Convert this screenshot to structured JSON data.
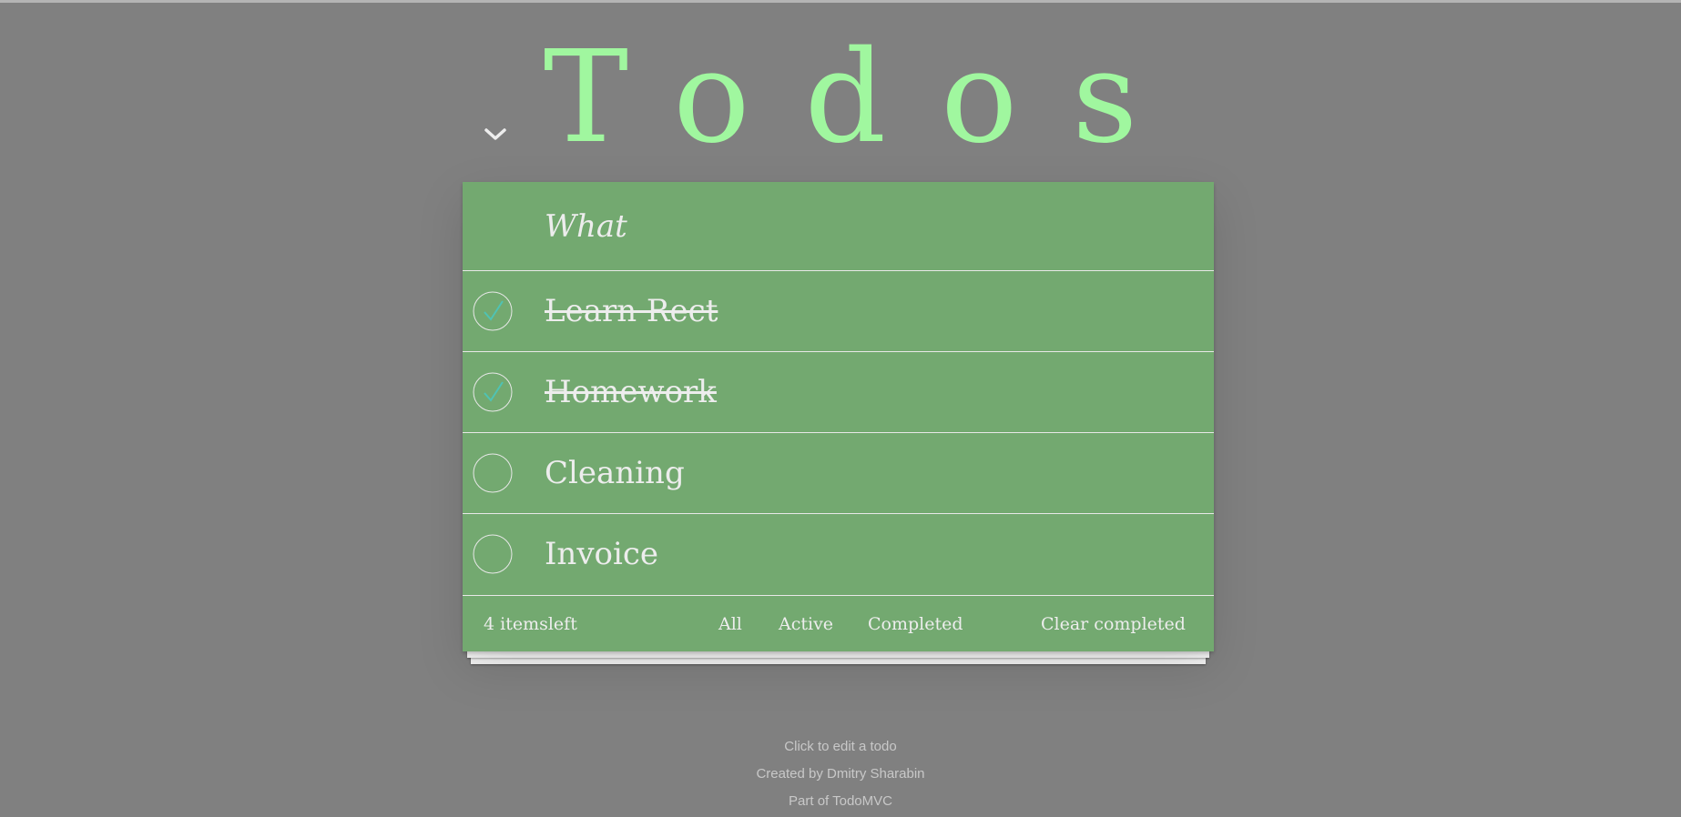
{
  "header": {
    "title": "Todos",
    "toggle_all_icon": "chevron-down-icon"
  },
  "new_todo": {
    "placeholder": "What"
  },
  "todos": [
    {
      "label": "Learn Rect",
      "completed": true
    },
    {
      "label": "Homework",
      "completed": true
    },
    {
      "label": "Cleaning",
      "completed": false
    },
    {
      "label": "Invoice",
      "completed": false
    }
  ],
  "footer": {
    "count": "4 itemsleft",
    "filters": [
      "All",
      "Active",
      "Completed"
    ],
    "clear_completed": "Clear completed"
  },
  "info": {
    "line1": "Click to edit a todo",
    "line2": "Created by Dmitry Sharabin",
    "line3": "Part of TodoMVC"
  },
  "colors": {
    "background": "#808080",
    "title": "#a0f79f",
    "panel": "#73a970",
    "text": "#ededed",
    "check": "#4fc3b4"
  }
}
